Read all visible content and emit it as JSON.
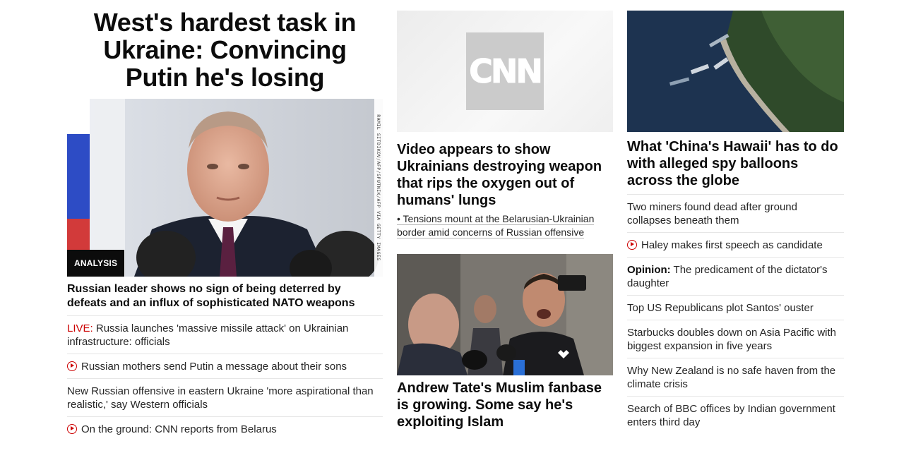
{
  "col1": {
    "title": "West's hardest task in Ukraine: Convincing Putin he's losing",
    "badge": "ANALYSIS",
    "photo_credit": "RAMIL SITDIKOV/AFP/SPUTNIK/AFP VIA GETTY IMAGES",
    "subhead": "Russian leader shows no sign of being deterred by defeats and an influx of sophisticated NATO weapons",
    "items": [
      {
        "prefix": "LIVE:",
        "text": " Russia launches 'massive missile attack' on Ukrainian infrastructure: officials"
      },
      {
        "icon": "play-icon",
        "text": "Russian mothers send Putin a message about their sons"
      },
      {
        "text": "New Russian offensive in eastern Ukraine 'more aspirational than realistic,' say Western officials"
      },
      {
        "icon": "play-icon",
        "text": "On the ground: CNN reports from Belarus"
      }
    ]
  },
  "col2": {
    "logo_text": "CNN",
    "story1": "Video appears to show Ukrainians destroying weapon that rips the oxygen out of humans' lungs",
    "story1_link": "• Tensions mount at the Belarusian-Ukrainian border amid concerns of Russian offensive",
    "story2": "Andrew Tate's Muslim fanbase is growing. Some say he's exploiting Islam"
  },
  "col3": {
    "headline": "What 'China's Hawaii' has to do with alleged spy balloons across the globe",
    "items": [
      {
        "text": "Two miners found dead after ground collapses beneath them"
      },
      {
        "icon": "play-icon",
        "text": "Haley makes first speech as candidate"
      },
      {
        "prefix": "Opinion:",
        "text": " The predicament of the dictator's daughter"
      },
      {
        "text": "Top US Republicans plot Santos' ouster"
      },
      {
        "text": "Starbucks doubles down on Asia Pacific with biggest expansion in five years"
      },
      {
        "text": "Why New Zealand is no safe haven from the climate crisis"
      },
      {
        "text": "Search of BBC offices by Indian government enters third day"
      }
    ]
  },
  "colors": {
    "accent_red": "#cc0000",
    "text": "#0c0c0c",
    "divider": "#e6e6e6"
  }
}
